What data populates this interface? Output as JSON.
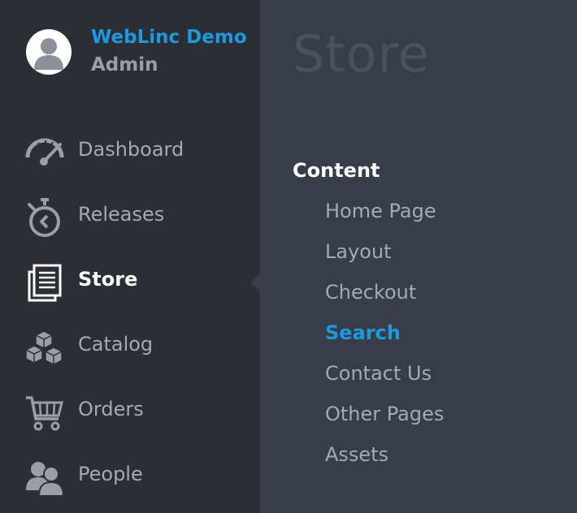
{
  "account": {
    "name": "WebLinc Demo",
    "role": "Admin"
  },
  "nav": {
    "items": [
      {
        "label": "Dashboard",
        "icon": "dashboard-gauge-icon"
      },
      {
        "label": "Releases",
        "icon": "stopwatch-icon"
      },
      {
        "label": "Store",
        "icon": "documents-icon",
        "active": true
      },
      {
        "label": "Catalog",
        "icon": "boxes-icon"
      },
      {
        "label": "Orders",
        "icon": "shopping-cart-icon"
      },
      {
        "label": "People",
        "icon": "people-icon"
      }
    ]
  },
  "main": {
    "title": "Store",
    "section": {
      "heading": "Content",
      "items": [
        {
          "label": "Home Page"
        },
        {
          "label": "Layout"
        },
        {
          "label": "Checkout"
        },
        {
          "label": "Search",
          "active": true
        },
        {
          "label": "Contact Us"
        },
        {
          "label": "Other Pages"
        },
        {
          "label": "Assets"
        }
      ]
    }
  },
  "colors": {
    "sidebar_bg": "#2b2e35",
    "main_bg": "#383d49",
    "accent": "#1b9ae0",
    "muted_text": "#a5a9b0",
    "title_text": "#4a505c"
  }
}
